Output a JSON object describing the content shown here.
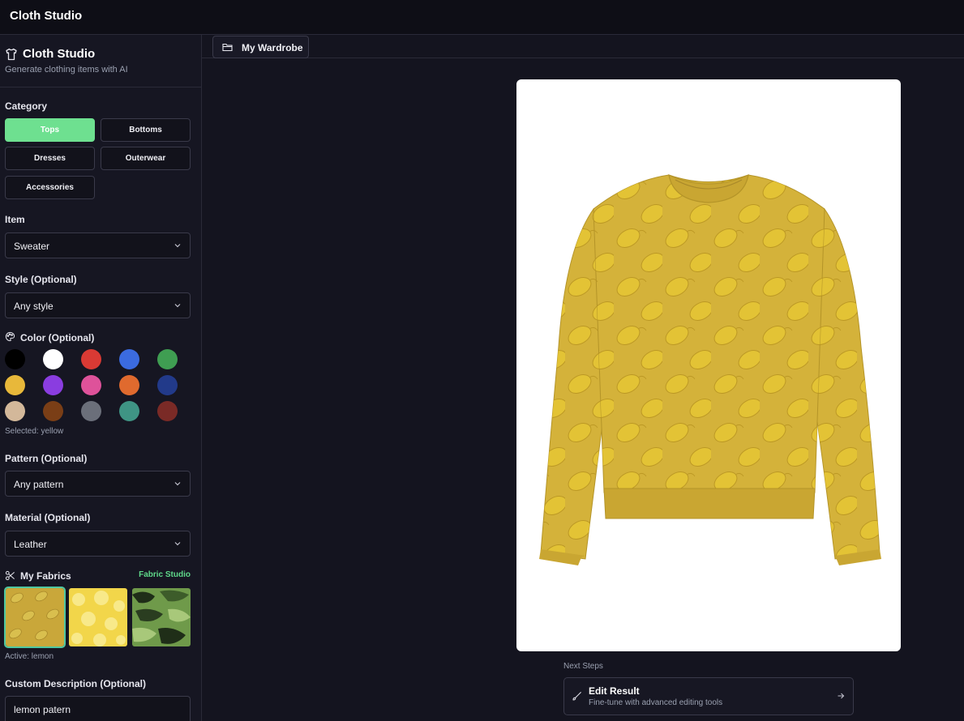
{
  "app": {
    "title": "Cloth Studio"
  },
  "sidebar": {
    "title": "Cloth Studio",
    "subtitle": "Generate clothing items with AI",
    "category": {
      "label": "Category",
      "options": [
        "Tops",
        "Bottoms",
        "Dresses",
        "Outerwear",
        "Accessories"
      ],
      "selected": "Tops"
    },
    "item": {
      "label": "Item",
      "value": "Sweater"
    },
    "style": {
      "label": "Style (Optional)",
      "value": "Any style"
    },
    "color": {
      "label": "Color (Optional)",
      "swatches": [
        "#000000",
        "#ffffff",
        "#d93a34",
        "#3b6be0",
        "#3f9e52",
        "#e8b83a",
        "#8a3de0",
        "#de529a",
        "#e06a2e",
        "#223a8a",
        "#d3b89a",
        "#7a3e16",
        "#6b6f7a",
        "#3f9484",
        "#7a2a26"
      ],
      "selected_text": "Selected: yellow"
    },
    "pattern": {
      "label": "Pattern (Optional)",
      "value": "Any pattern"
    },
    "material": {
      "label": "Material (Optional)",
      "value": "Leather"
    },
    "fabrics": {
      "label": "My Fabrics",
      "link": "Fabric Studio",
      "active_text": "Active: lemon"
    },
    "description": {
      "label": "Custom Description (Optional)",
      "value": "lemon patern"
    }
  },
  "tabs": {
    "wardrobe": "My Wardrobe"
  },
  "next_steps": {
    "label": "Next Steps",
    "edit_title": "Edit Result",
    "edit_desc": "Fine-tune with advanced editing tools"
  },
  "icons": [
    "shirt-icon",
    "chevron-down-icon",
    "palette-icon",
    "scissors-icon",
    "folder-icon",
    "brush-icon",
    "arrow-right-icon"
  ]
}
